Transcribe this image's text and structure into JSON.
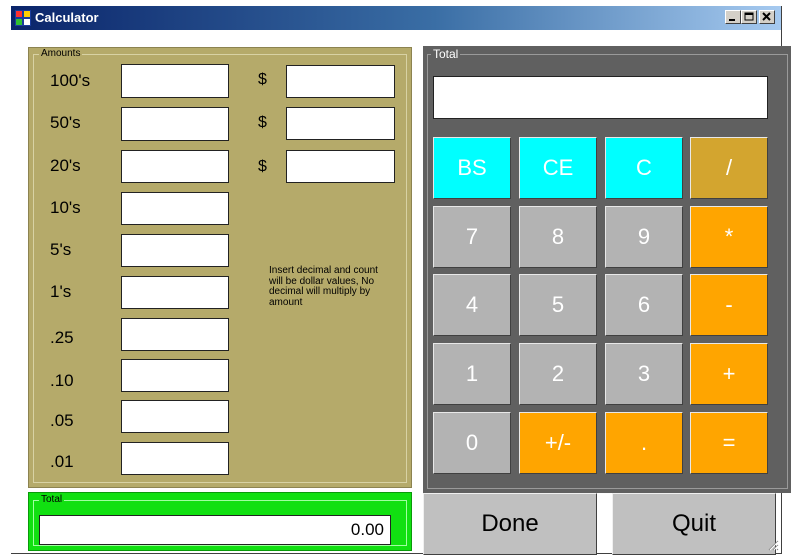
{
  "window": {
    "title": "Calculator"
  },
  "amounts": {
    "legend": "Amounts",
    "rows": [
      {
        "label": "100's",
        "value": "",
        "dollar": "$",
        "dollar_value": ""
      },
      {
        "label": "50's",
        "value": "",
        "dollar": "$",
        "dollar_value": ""
      },
      {
        "label": "20's",
        "value": "",
        "dollar": "$",
        "dollar_value": ""
      },
      {
        "label": "10's",
        "value": ""
      },
      {
        "label": "5's",
        "value": ""
      },
      {
        "label": "1's",
        "value": ""
      },
      {
        "label": ".25",
        "value": ""
      },
      {
        "label": ".10",
        "value": ""
      },
      {
        "label": ".05",
        "value": ""
      },
      {
        "label": ".01",
        "value": ""
      }
    ],
    "hint": "Insert decimal and count will be dollar values, No decimal will multiply by amount"
  },
  "total_left": {
    "legend": "Total",
    "value": "0.00"
  },
  "calculator": {
    "legend": "Total",
    "display": "",
    "keys": [
      [
        "BS",
        "CE",
        "C",
        "/"
      ],
      [
        "7",
        "8",
        "9",
        "*"
      ],
      [
        "4",
        "5",
        "6",
        "-"
      ],
      [
        "1",
        "2",
        "3",
        "+"
      ],
      [
        "0",
        "+/-",
        ".",
        "="
      ]
    ]
  },
  "buttons": {
    "done": "Done",
    "quit": "Quit"
  },
  "colors": {
    "amounts_bg": "#b5aa6a",
    "total_bg": "#11e011",
    "cyan": "#00ffff",
    "orange": "#ffa500",
    "gold": "#d3a52f",
    "gray": "#b3b3b3",
    "calc_bg": "#606060"
  }
}
